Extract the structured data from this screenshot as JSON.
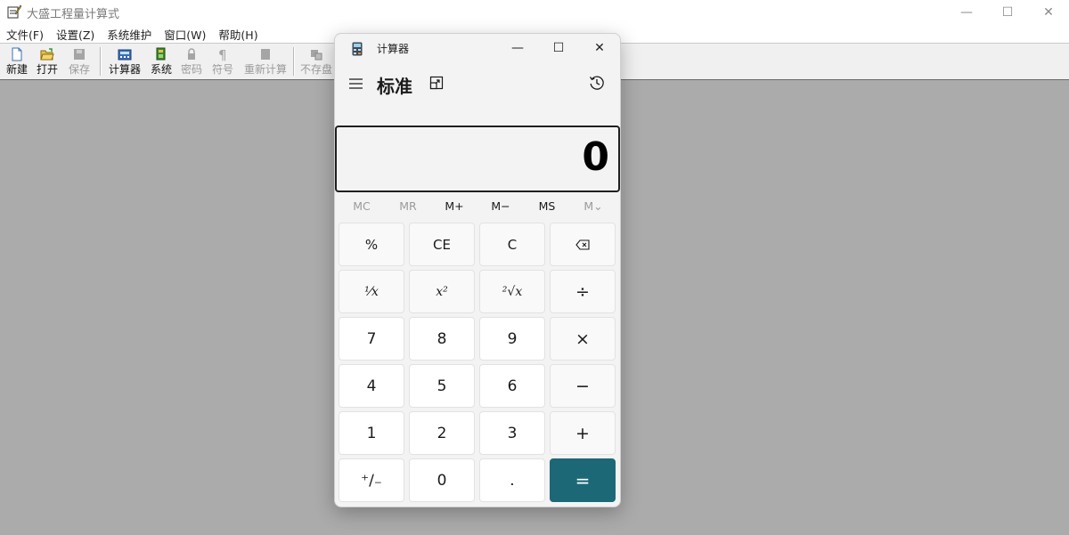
{
  "app": {
    "title": "大盛工程量计算式",
    "window_controls": {
      "minimize": "—",
      "maximize": "☐",
      "close": "✕"
    },
    "menu": [
      "文件(F)",
      "设置(Z)",
      "系统维护",
      "窗口(W)",
      "帮助(H)"
    ],
    "toolbar": [
      {
        "label": "新建",
        "icon": "new-document-icon",
        "enabled": true
      },
      {
        "label": "打开",
        "icon": "open-folder-icon",
        "enabled": true
      },
      {
        "label": "保存",
        "icon": "save-icon",
        "enabled": false
      },
      {
        "label": "计算器",
        "icon": "calculator-icon",
        "enabled": true
      },
      {
        "label": "系统",
        "icon": "system-icon",
        "enabled": true
      },
      {
        "label": "密码",
        "icon": "lock-icon",
        "enabled": false
      },
      {
        "label": "符号",
        "icon": "pilcrow-icon",
        "enabled": false
      },
      {
        "label": "重新计算",
        "icon": "recalculate-icon",
        "enabled": false
      },
      {
        "label": "不存盘",
        "icon": "no-save-icon",
        "enabled": false
      }
    ]
  },
  "calculator": {
    "title": "计算器",
    "mode": "标准",
    "display": "0",
    "window_controls": {
      "minimize": "—",
      "maximize": "☐",
      "close": "✕"
    },
    "memory": [
      {
        "label": "MC",
        "enabled": false
      },
      {
        "label": "MR",
        "enabled": false
      },
      {
        "label": "M+",
        "enabled": true
      },
      {
        "label": "M−",
        "enabled": true
      },
      {
        "label": "MS",
        "enabled": true
      },
      {
        "label": "M⌄",
        "enabled": false
      }
    ],
    "keys": {
      "percent": "%",
      "clear_entry": "CE",
      "clear": "C",
      "backspace": "⌫",
      "reciprocal": "¹⁄x",
      "square": "x²",
      "sqrt": "²√x",
      "divide": "÷",
      "seven": "7",
      "eight": "8",
      "nine": "9",
      "multiply": "×",
      "four": "4",
      "five": "5",
      "six": "6",
      "subtract": "−",
      "one": "1",
      "two": "2",
      "three": "3",
      "add": "+",
      "negate": "⁺∕₋",
      "zero": "0",
      "decimal": ".",
      "equals": "="
    },
    "accent_color": "#1c6877"
  }
}
